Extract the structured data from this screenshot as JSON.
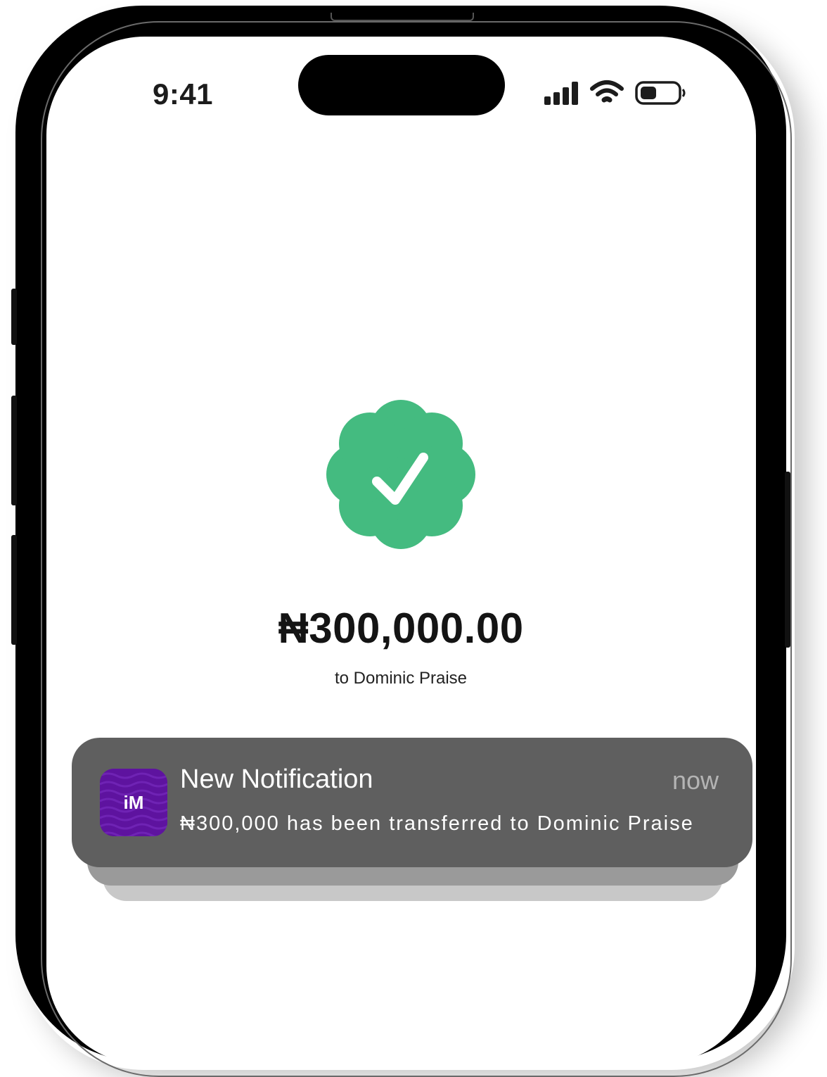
{
  "status_bar": {
    "time": "9:41",
    "icons": [
      "cellular-signal-icon",
      "wifi-icon",
      "battery-icon"
    ]
  },
  "success": {
    "icon": "verified-check-badge-icon",
    "amount": "₦300,000.00",
    "recipient": "to Dominic Praise"
  },
  "notification": {
    "app_icon_text": "iM",
    "title": "New Notification",
    "time": "now",
    "body": "₦300,000 has been transferred to Dominic Praise"
  },
  "colors": {
    "success_green": "#44bb80",
    "notification_bg": "#5f5f5f",
    "app_icon_purple": "#5e139f"
  }
}
